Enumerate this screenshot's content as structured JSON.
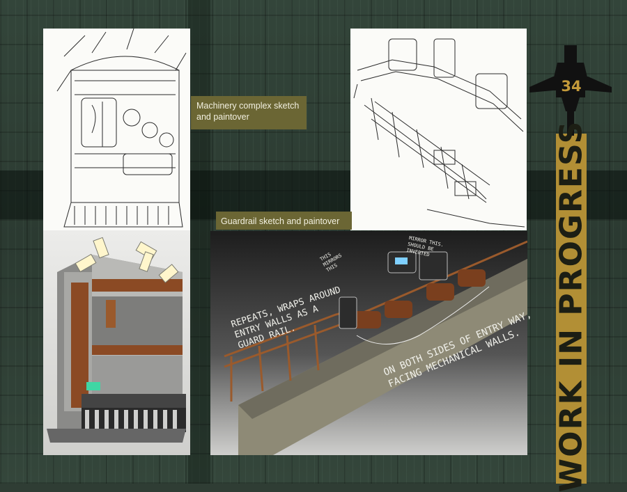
{
  "captions": {
    "machinery": "Machinery complex sketch and paintover",
    "guardrail": "Guardrail sketch and paintover"
  },
  "sidebar": {
    "page_number": "34",
    "vertical_title": "WORK IN PROGRESS",
    "banner_color": "#b28f35"
  },
  "annotations": {
    "repeats": "REPEATS, WRAPS AROUND ENTRY WALLS AS A GUARD RAIL.",
    "both_sides": "ON BOTH SIDES OF ENTRY WAY, FACING MECHANICAL WALLS.",
    "mirrors": "THIS MIRRORS THIS",
    "inverted": "MIRROR THIS. SHOULD BE INVERTED"
  },
  "icons": [
    "spaceship-icon"
  ]
}
